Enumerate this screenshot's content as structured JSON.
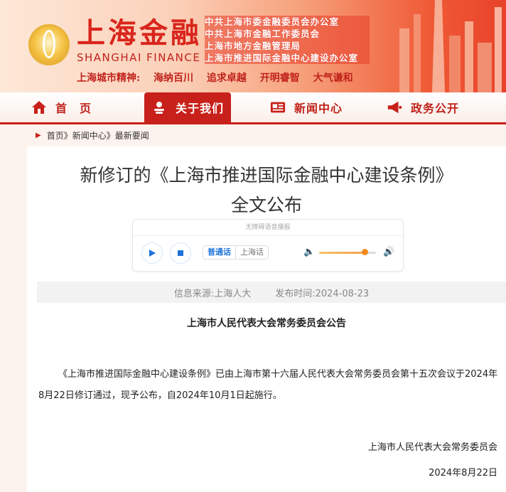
{
  "header": {
    "brand_cn": "上海金融",
    "brand_en": "SHANGHAI FINANCE",
    "offices": [
      "中共上海市委金融委员会办公室",
      "中共上海市金融工作委员会",
      "上海市地方金融管理局",
      "上海市推进国际金融中心建设办公室"
    ],
    "spirit_label": "上海城市精神:",
    "spirit_items": [
      "海纳百川",
      "追求卓越",
      "开明睿智",
      "大气谦和"
    ]
  },
  "nav": {
    "items": [
      {
        "label": "首　页",
        "icon": "home-icon"
      },
      {
        "label": "关于我们",
        "icon": "about-icon",
        "active": true
      },
      {
        "label": "新闻中心",
        "icon": "news-icon"
      },
      {
        "label": "政务公开",
        "icon": "megaphone-icon"
      }
    ]
  },
  "breadcrumb": "首页》新闻中心》最新要闻",
  "article": {
    "title_line1": "新修订的《上海市推进国际金融中心建设条例》",
    "title_line2": "全文公布",
    "source": "信息来源:上海人大",
    "publish_time": "发布时间:2024-08-23",
    "heading": "上海市人民代表大会常务委员会公告",
    "paragraph": "《上海市推进国际金融中心建设条例》已由上海市第十六届人民代表大会常务委员会第十五次会议于2024年8月22日修订通过，现予公布，自2024年10月1日起施行。",
    "signature": "上海市人民代表大会常务委员会",
    "date": "2024年8月22日"
  },
  "player": {
    "top_label": "无障碍语音播报",
    "lang_active": "普通话",
    "lang_other": "上海话",
    "volume_level": 0.8
  },
  "colors": {
    "brand_red": "#c8201a",
    "accent_blue": "#1e73d8"
  }
}
